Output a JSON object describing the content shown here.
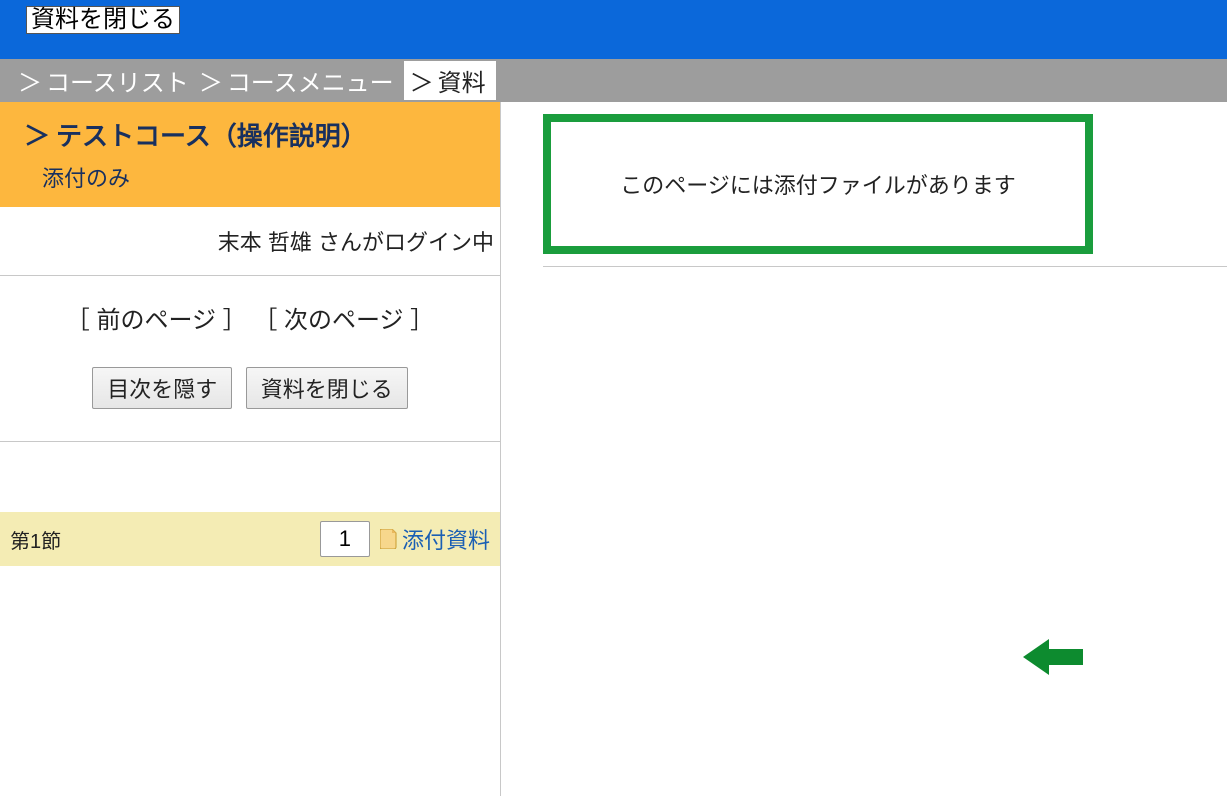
{
  "topbar": {
    "close_button": "資料を閉じる"
  },
  "breadcrumb": {
    "sep": "＞",
    "items": [
      "コースリスト",
      "コースメニュー"
    ],
    "current": "資料"
  },
  "course": {
    "title": "テストコース（操作説明）",
    "chevron": "＞",
    "subtitle": "添付のみ"
  },
  "login_status": "末本  哲雄 さんがログイン中",
  "nav": {
    "prev": "［ 前のページ ］",
    "next": "［ 次のページ ］"
  },
  "buttons": {
    "hide_toc": "目次を隠す",
    "close_material": "資料を閉じる"
  },
  "section": {
    "label": "第1節",
    "page_no": "1",
    "attach_label": "添付資料"
  },
  "callout_text": "このページには添付ファイルがあります"
}
